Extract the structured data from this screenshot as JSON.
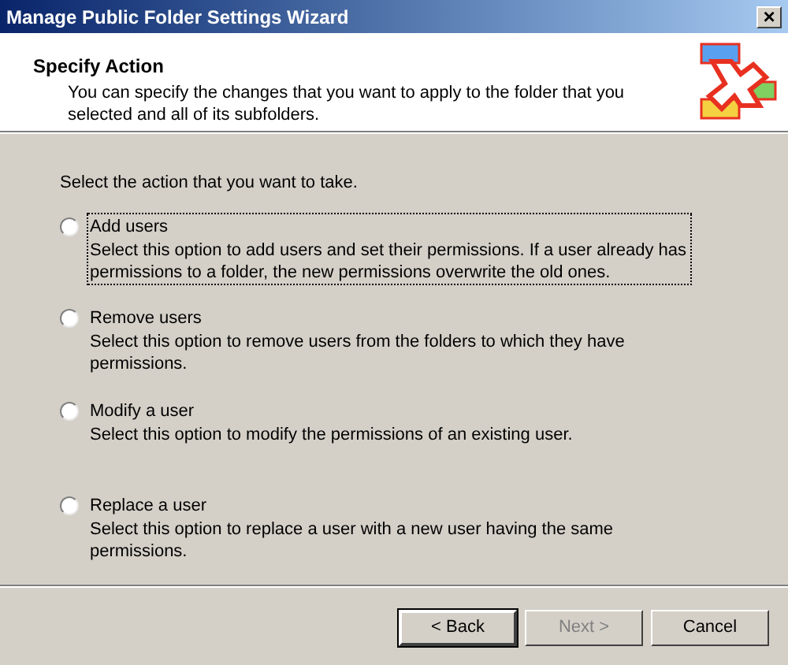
{
  "window": {
    "title": "Manage Public Folder Settings Wizard",
    "close": "×"
  },
  "header": {
    "title": "Specify Action",
    "description": "You can specify the changes that you want to apply to the folder that you selected and all of its subfolders."
  },
  "prompt": "Select the action that you want to take.",
  "options": [
    {
      "label": "Add users",
      "description": "Select this option to add users and set their permissions. If a user already has permissions to a folder, the new permissions overwrite the old ones.",
      "selected": false,
      "focused": true
    },
    {
      "label": "Remove users",
      "description": "Select this option to remove users from the folders to which they have permissions.",
      "selected": false,
      "focused": false
    },
    {
      "label": "Modify a user",
      "description": "Select this option to modify the permissions of an existing user.",
      "selected": false,
      "focused": false
    },
    {
      "label": "Replace a user",
      "description": "Select this option to replace a user with a new user having the same permissions.",
      "selected": false,
      "focused": false
    }
  ],
  "buttons": [
    {
      "label": "< Back",
      "default": true,
      "disabled": false
    },
    {
      "label": "Next >",
      "default": false,
      "disabled": true
    },
    {
      "label": "Cancel",
      "default": false,
      "disabled": false
    }
  ]
}
